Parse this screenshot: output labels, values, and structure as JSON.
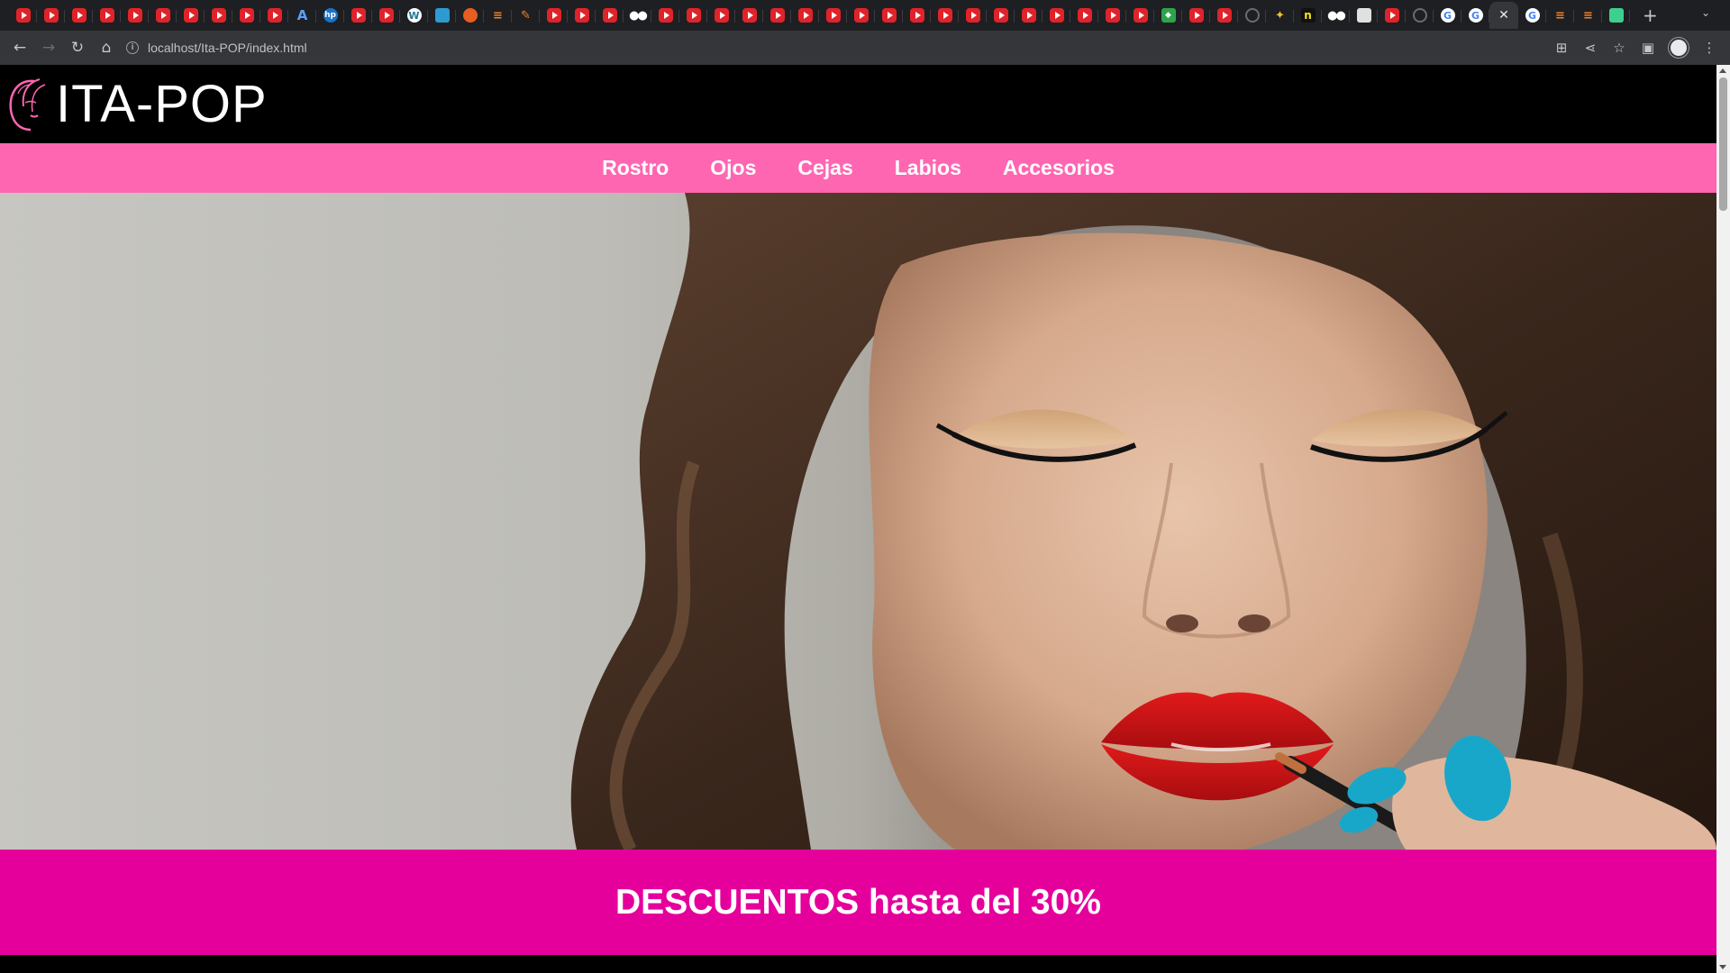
{
  "browser": {
    "tabs": [
      {
        "icon": "youtube-icon"
      },
      {
        "icon": "youtube-icon"
      },
      {
        "icon": "youtube-icon"
      },
      {
        "icon": "youtube-icon"
      },
      {
        "icon": "youtube-icon"
      },
      {
        "icon": "youtube-icon"
      },
      {
        "icon": "youtube-icon"
      },
      {
        "icon": "youtube-icon"
      },
      {
        "icon": "youtube-icon"
      },
      {
        "icon": "youtube-icon"
      },
      {
        "icon": "arch-icon"
      },
      {
        "icon": "hp-icon"
      },
      {
        "icon": "youtube-icon"
      },
      {
        "icon": "youtube-icon"
      },
      {
        "icon": "wordpress-icon"
      },
      {
        "icon": "blue-app-icon"
      },
      {
        "icon": "orange-app-icon"
      },
      {
        "icon": "stackoverflow-icon"
      },
      {
        "icon": "pen-icon"
      },
      {
        "icon": "youtube-icon"
      },
      {
        "icon": "youtube-icon"
      },
      {
        "icon": "youtube-icon"
      },
      {
        "icon": "medium-icon"
      },
      {
        "icon": "youtube-icon"
      },
      {
        "icon": "youtube-icon"
      },
      {
        "icon": "youtube-icon"
      },
      {
        "icon": "youtube-icon"
      },
      {
        "icon": "youtube-icon"
      },
      {
        "icon": "youtube-icon"
      },
      {
        "icon": "youtube-icon"
      },
      {
        "icon": "youtube-icon"
      },
      {
        "icon": "youtube-icon"
      },
      {
        "icon": "youtube-icon"
      },
      {
        "icon": "youtube-icon"
      },
      {
        "icon": "youtube-icon"
      },
      {
        "icon": "youtube-icon"
      },
      {
        "icon": "youtube-icon"
      },
      {
        "icon": "youtube-icon"
      },
      {
        "icon": "youtube-icon"
      },
      {
        "icon": "youtube-icon"
      },
      {
        "icon": "youtube-icon"
      },
      {
        "icon": "green-app-icon"
      },
      {
        "icon": "youtube-icon"
      },
      {
        "icon": "youtube-icon"
      },
      {
        "icon": "github-icon"
      },
      {
        "icon": "sparkle-icon"
      },
      {
        "icon": "n-icon"
      },
      {
        "icon": "medium-icon"
      },
      {
        "icon": "document-icon"
      },
      {
        "icon": "youtube-icon"
      },
      {
        "icon": "github-icon"
      },
      {
        "icon": "google-icon"
      },
      {
        "icon": "google-icon"
      },
      {
        "icon": "close-icon",
        "active": true
      },
      {
        "icon": "google-icon"
      },
      {
        "icon": "stackoverflow-icon"
      },
      {
        "icon": "stackoverflow-icon"
      },
      {
        "icon": "supabase-icon"
      }
    ],
    "url": "localhost/Ita-POP/index.html"
  },
  "site": {
    "logo_text": "ITA-POP",
    "nav": [
      "Rostro",
      "Ojos",
      "Cejas",
      "Labios",
      "Accesorios"
    ],
    "promo_text": "DESCUENTOS hasta del 30%"
  },
  "colors": {
    "header_bg": "#000000",
    "nav_bg": "#ff66b2",
    "promo_bg": "#e5009c",
    "text": "#ffffff"
  }
}
